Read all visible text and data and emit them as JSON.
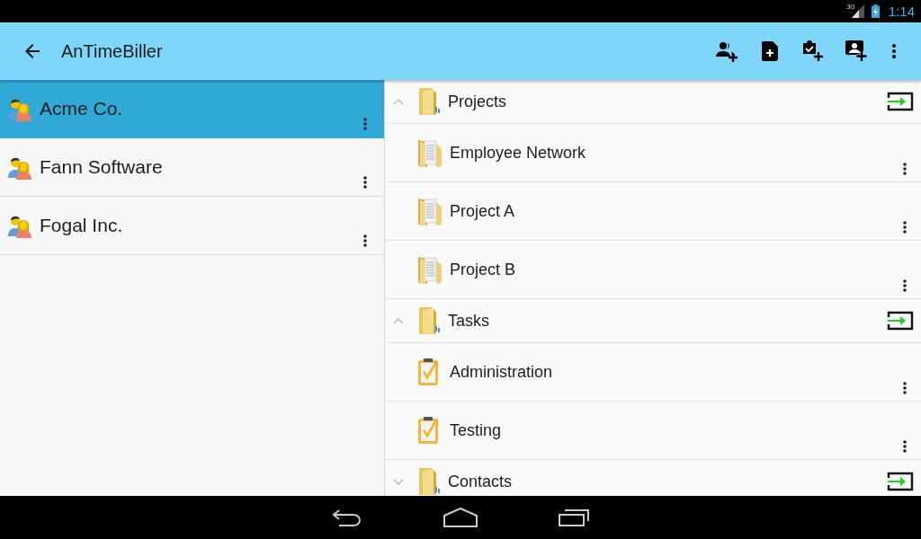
{
  "status_bar": {
    "network": "3G",
    "time": "1:14"
  },
  "app_bar": {
    "title": "AnTimeBiller"
  },
  "clients": [
    {
      "name": "Acme Co.",
      "selected": true
    },
    {
      "name": "Fann Software",
      "selected": false
    },
    {
      "name": "Fogal Inc.",
      "selected": false
    }
  ],
  "groups": [
    {
      "label": "Projects",
      "expanded": true,
      "children": [
        {
          "label": "Employee Network",
          "kind": "project"
        },
        {
          "label": "Project A",
          "kind": "project"
        },
        {
          "label": "Project B",
          "kind": "project"
        }
      ]
    },
    {
      "label": "Tasks",
      "expanded": true,
      "children": [
        {
          "label": "Administration",
          "kind": "task"
        },
        {
          "label": "Testing",
          "kind": "task"
        }
      ]
    },
    {
      "label": "Contacts",
      "expanded": false
    }
  ]
}
